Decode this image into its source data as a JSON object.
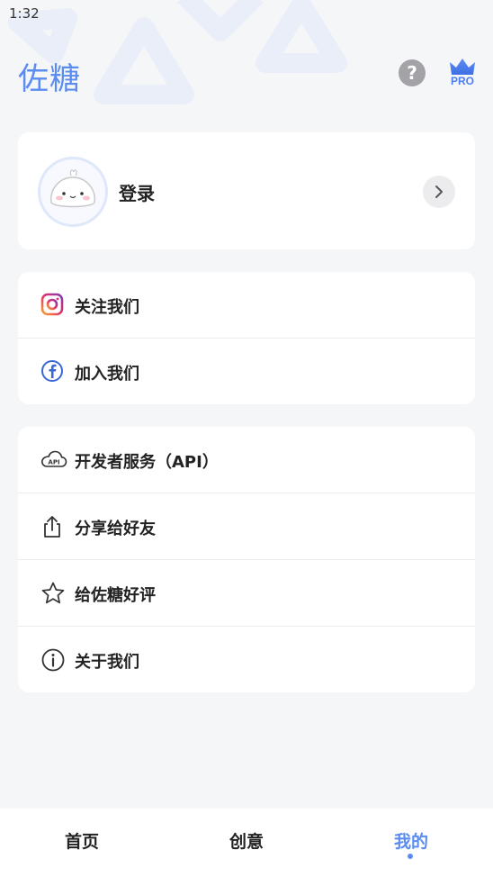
{
  "status_bar": {
    "time": "1:32"
  },
  "header": {
    "title": "佐糖",
    "help_icon": "question-circle-icon",
    "help_glyph": "?",
    "pro_icon": "crown-icon",
    "pro_label": "PRO"
  },
  "login_card": {
    "avatar_icon": "bun-mascot-icon",
    "label": "登录",
    "chevron_icon": "chevron-right-icon"
  },
  "social": [
    {
      "icon": "instagram-icon",
      "label": "关注我们"
    },
    {
      "icon": "facebook-icon",
      "label": "加入我们"
    }
  ],
  "tools": [
    {
      "icon": "cloud-api-icon",
      "label": "开发者服务（API）"
    },
    {
      "icon": "share-icon",
      "label": "分享给好友"
    },
    {
      "icon": "star-icon",
      "label": "给佐糖好评"
    },
    {
      "icon": "info-icon",
      "label": "关于我们"
    }
  ],
  "bottom_nav": {
    "tabs": [
      {
        "label": "首页",
        "active": false
      },
      {
        "label": "创意",
        "active": false
      },
      {
        "label": "我的",
        "active": true
      }
    ]
  },
  "colors": {
    "accent": "#5b8cf0",
    "background": "#f5f6f8",
    "card": "#ffffff"
  }
}
